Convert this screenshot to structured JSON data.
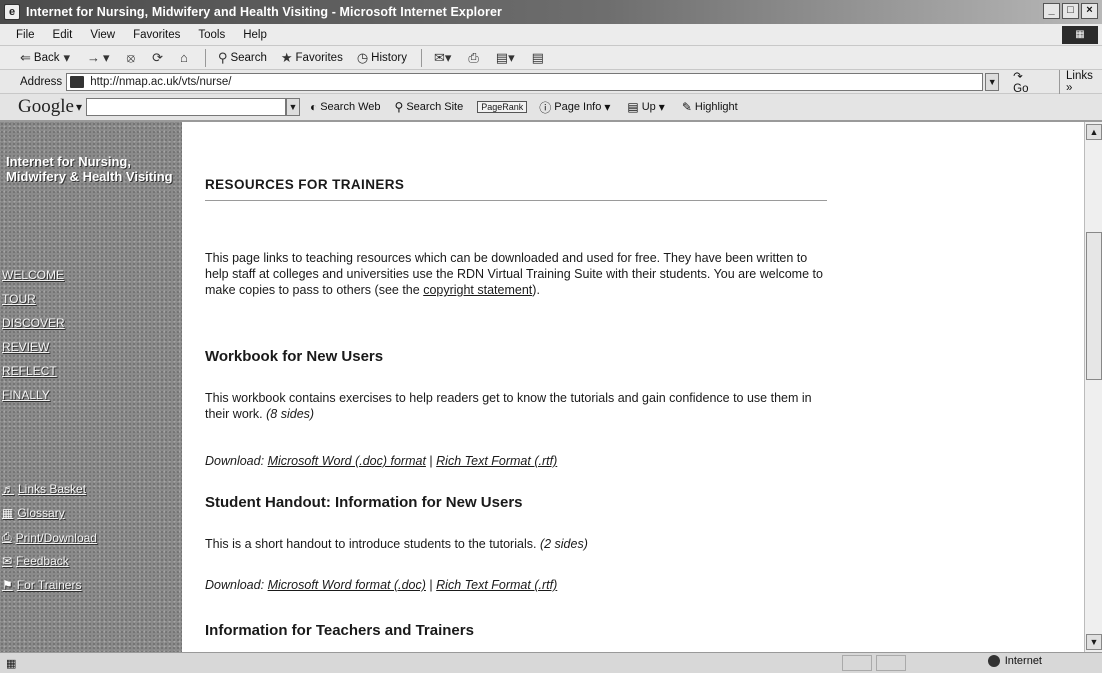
{
  "window": {
    "title": "Internet for Nursing, Midwifery and Health Visiting - Microsoft Internet Explorer"
  },
  "menu": [
    "File",
    "Edit",
    "View",
    "Favorites",
    "Tools",
    "Help"
  ],
  "toolbar": {
    "back": "Back",
    "search": "Search",
    "favorites": "Favorites",
    "history": "History"
  },
  "address": {
    "label": "Address",
    "url": "http://nmap.ac.uk/vts/nurse/",
    "go": "Go",
    "links": "Links »"
  },
  "google": {
    "logo": "Google",
    "search_web": "Search Web",
    "search_site": "Search Site",
    "pagerank": "PageRank",
    "page_info": "Page Info",
    "up": "Up",
    "highlight": "Highlight"
  },
  "sidebar": {
    "title": "Internet for Nursing, Midwifery & Health Visiting",
    "links": [
      "WELCOME",
      "TOUR",
      "DISCOVER",
      "REVIEW",
      "REFLECT",
      "FINALLY"
    ],
    "tools": [
      "Links Basket",
      "Glossary",
      "Print/Download",
      "Feedback",
      "For Trainers"
    ]
  },
  "main": {
    "heading": "RESOURCES FOR TRAINERS",
    "intro_text": "This page links to teaching resources which can be downloaded and used for free. They have been written to help staff at colleges and universities use the RDN Virtual Training Suite with their students. You are welcome to make copies to pass to others (see the",
    "intro_link": "copyright statement",
    "intro_end": ").",
    "section1_title": "Workbook for New Users",
    "section1_text": "This workbook contains exercises to help readers get to know the tutorials and gain confidence to use them in their work.",
    "section1_sides": "(8 sides)",
    "download_label": "Download:",
    "section1_link1": "Microsoft Word (.doc) format",
    "section1_link2": "Rich Text Format (.rtf)",
    "section2_title": "Student Handout: Information for New Users",
    "section2_text": "This is a short handout to introduce students to the tutorials.",
    "section2_sides": "(2 sides)",
    "section2_link1": "Microsoft Word format (.doc)",
    "section2_link2": "Rich Text Format (.rtf)",
    "section3_title": "Information for Teachers and Trainers",
    "separator": "|"
  },
  "status": {
    "zone": "Internet"
  }
}
